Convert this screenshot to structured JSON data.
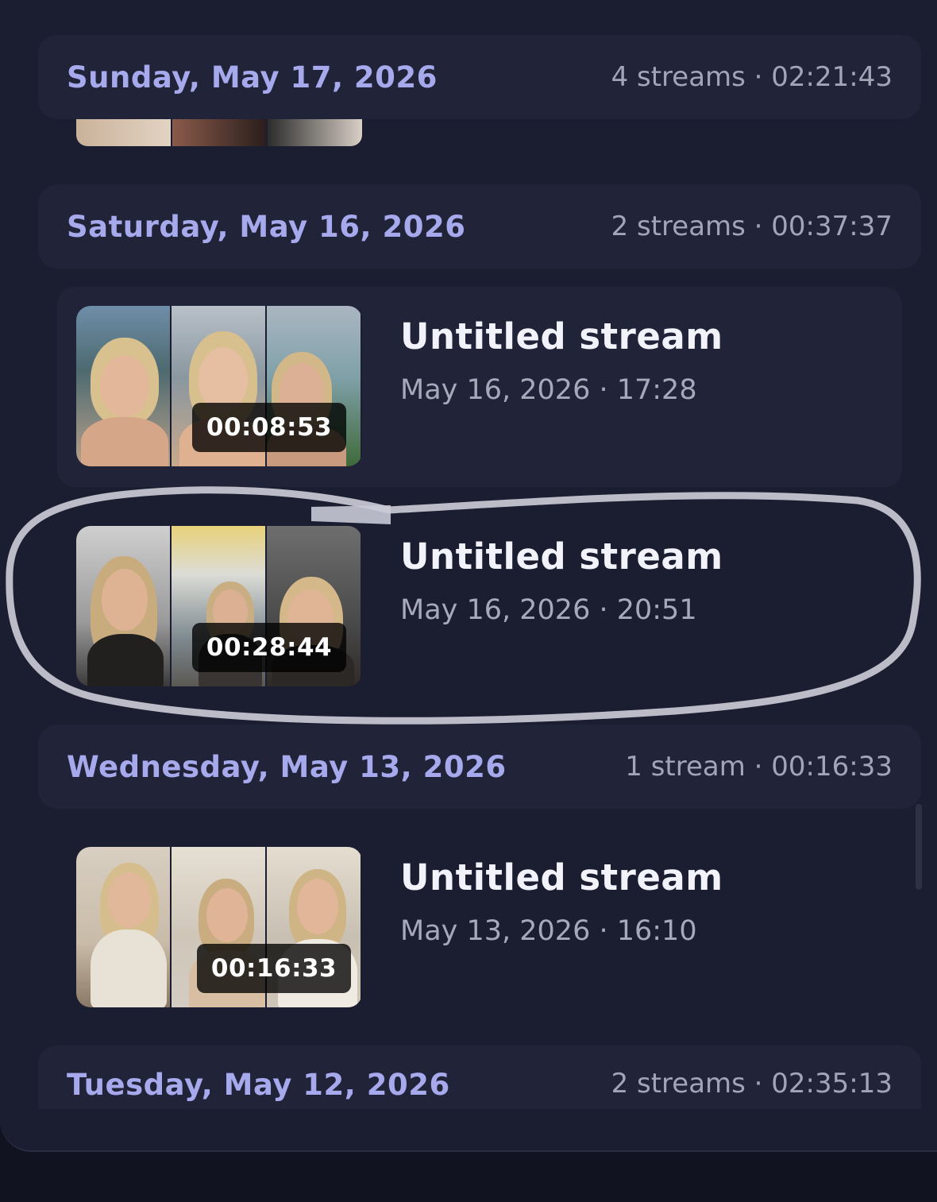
{
  "days": [
    {
      "title": "Sunday, May 17, 2026",
      "meta": "4 streams · 02:21:43"
    },
    {
      "title": "Saturday, May 16, 2026",
      "meta": "2 streams · 00:37:37"
    },
    {
      "title": "Wednesday, May 13, 2026",
      "meta": "1 stream · 00:16:33"
    },
    {
      "title": "Tuesday, May 12, 2026",
      "meta": "2 streams · 02:35:13"
    }
  ],
  "streams": [
    {
      "title": "Untitled stream",
      "date": "May 16, 2026 · 17:28",
      "duration": "00:08:53"
    },
    {
      "title": "Untitled stream",
      "date": "May 16, 2026 · 20:51",
      "duration": "00:28:44"
    },
    {
      "title": "Untitled stream",
      "date": "May 13, 2026 · 16:10",
      "duration": "00:16:33"
    }
  ],
  "colors": {
    "background": "#1b1d30",
    "header_background": "#212339",
    "day_title": "#a6a9ec",
    "meta_text": "#a2a4b8",
    "stream_title": "#f1f2fa",
    "highlight_ring": "#c9cad6"
  }
}
